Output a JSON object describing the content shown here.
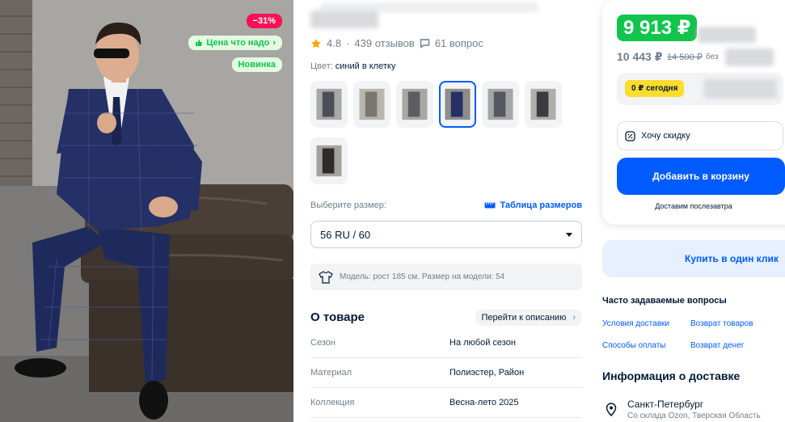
{
  "photo": {
    "badges": {
      "discount": "−31%",
      "price_good": "Цена что надо",
      "new": "Новинка"
    }
  },
  "product": {
    "rating": "4.8",
    "reviews": "439 отзывов",
    "questions": "61 вопрос",
    "color_label": "Цвет:",
    "color_value": "синий в клетку",
    "size_label": "Выберите размер:",
    "size_table": "Таблица размеров",
    "size_selected": "56 RU / 60",
    "model_info": "Модель: рост 185 см. Размер на модели: 54",
    "about_title": "О товаре",
    "goto_description": "Перейти к описанию",
    "specs": [
      {
        "key": "Сезон",
        "value": "На любой сезон"
      },
      {
        "key": "Материал",
        "value": "Полиэстер, Район"
      },
      {
        "key": "Коллекция",
        "value": "Весна-лето 2025"
      }
    ]
  },
  "price": {
    "main": "9 913 ₽",
    "main_suffix": "с",
    "old": "10 443 ₽",
    "crossed": "14 500 ₽",
    "old_suffix": "без",
    "today": "0 ₽ сегодня",
    "discount_request": "Хочу скидку",
    "add_to_cart": "Добавить в корзину",
    "delivery_note": "Доставим послезавтра",
    "one_click": "Купить в один клик"
  },
  "faq": {
    "title": "Часто задаваемые вопросы",
    "links": [
      "Условия доставки",
      "Возврат товаров",
      "Способы оплаты",
      "Возврат денег"
    ]
  },
  "delivery": {
    "title": "Информация о доставке",
    "city": "Санкт-Петербург",
    "source": "Со склада Ozon, Тверская Область"
  },
  "colors": {
    "green": "#10c44c",
    "blue": "#005bff",
    "pink": "#f91155",
    "yellow": "#fedc2f"
  }
}
